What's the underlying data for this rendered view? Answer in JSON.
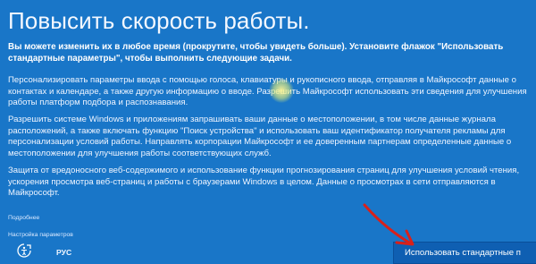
{
  "page": {
    "title": "Повысить скорость работы.",
    "intro": "Вы можете изменить их в любое время (прокрутите, чтобы увидеть больше). Установите флажок \"Использовать стандартные параметры\", чтобы выполнить следующие задачи.",
    "paragraphs": [
      "Персонализировать параметры ввода с помощью голоса, клавиатуры и рукописного ввода, отправляя в Майкрософт данные о контактах и календаре, а также другую информацию о вводе. Разрешить Майкрософт использовать эти сведения для улучшения работы платформ подбора и распознавания.",
      "Разрешить системе Windows и приложениям запрашивать ваши данные о местоположении, в том числе данные журнала расположений, а также включать функцию \"Поиск устройства\" и использовать ваш идентификатор получателя рекламы для персонализации условий работы. Направлять корпорации Майкрософт и ее доверенным партнерам определенные данные о местоположении для улучшения работы соответствующих служб.",
      "Защита от вредоносного веб-содержимого и использование функции прогнозирования страниц для улучшения условий чтения, ускорения просмотра веб-страниц и работы с браузерами Windows в целом. Данные о просмотрах в сети отправляются в Майкрософт."
    ],
    "links": {
      "more": "Подробнее",
      "settings": "Настройка параметров"
    }
  },
  "footer": {
    "accessibility_icon": "accessibility-icon",
    "language": "РУС",
    "primary_button": "Использовать стандартные п"
  },
  "colors": {
    "background": "#1976c8",
    "button": "#0f5fb2",
    "arrow": "#d9201a"
  }
}
